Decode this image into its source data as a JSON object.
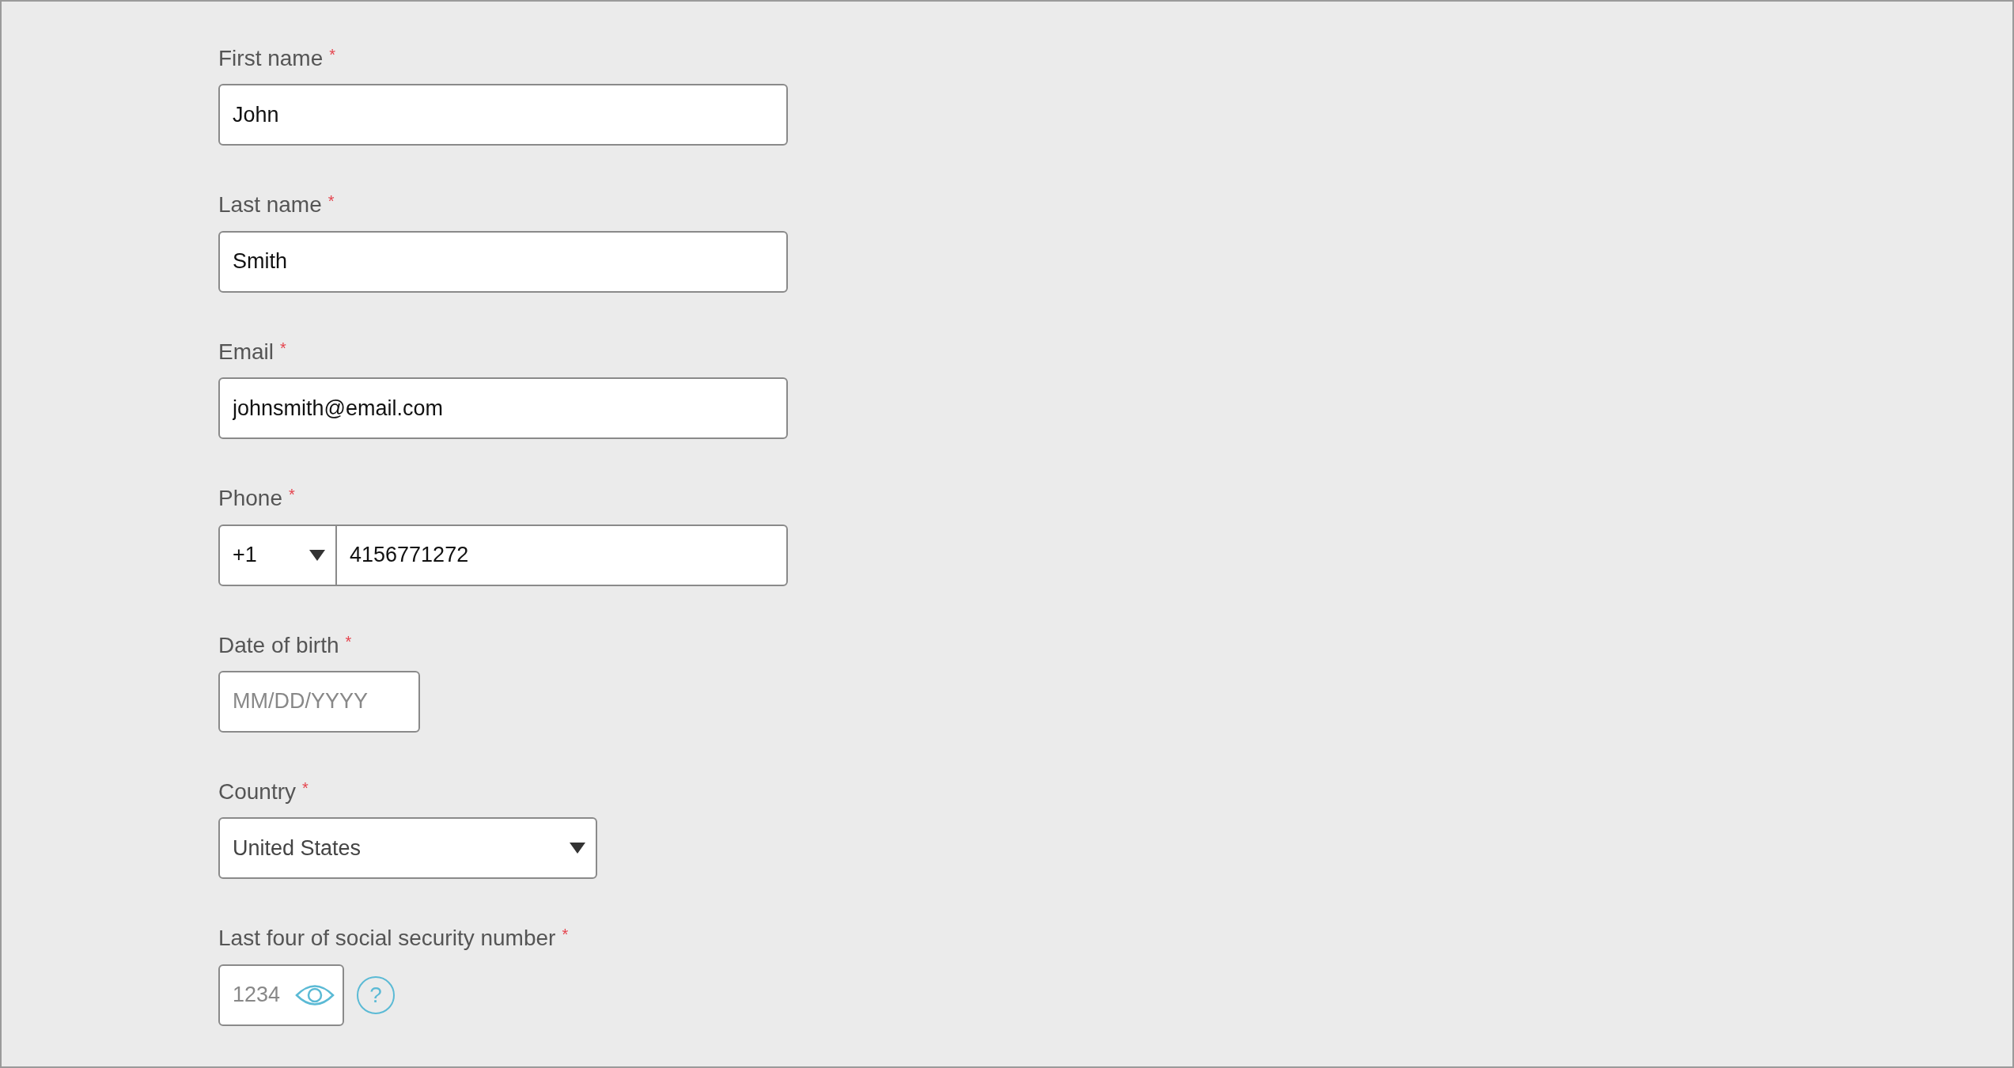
{
  "required_mark": "*",
  "fields": [
    {
      "kind": "text",
      "label": "First name",
      "required": true,
      "value": "John"
    },
    {
      "kind": "text",
      "label": "Last name",
      "required": true,
      "value": "Smith"
    },
    {
      "kind": "text",
      "label": "Email",
      "required": true,
      "value": "johnsmith@email.com"
    },
    {
      "kind": "phone",
      "label": "Phone",
      "required": true,
      "code": "+1",
      "value": "4156771272"
    },
    {
      "kind": "date",
      "label": "Date of birth",
      "required": true,
      "placeholder": "MM/DD/YYYY"
    },
    {
      "kind": "select",
      "label": "Country",
      "required": true,
      "value": "United States"
    },
    {
      "kind": "secret",
      "label": "Last four of social security number",
      "required": true,
      "placeholder": "1234",
      "help": "?"
    }
  ]
}
